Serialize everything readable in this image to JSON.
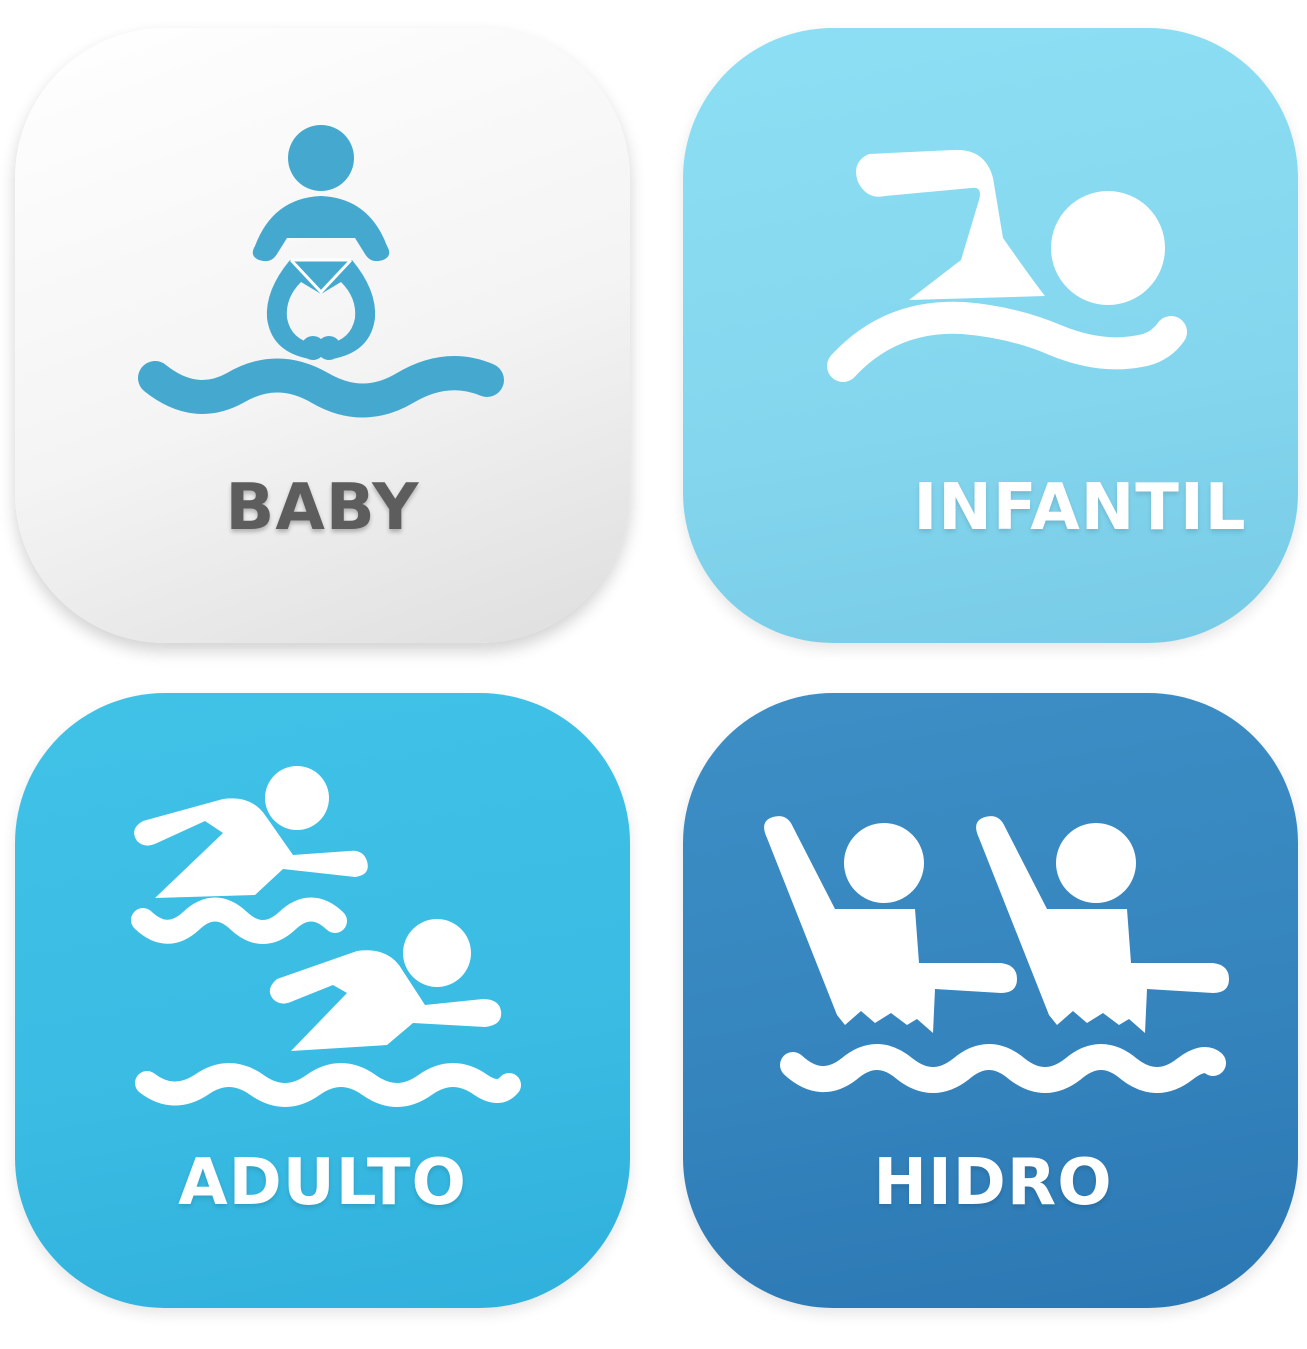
{
  "tiles": [
    {
      "id": "baby",
      "label": "BABY",
      "icon": "baby-swim-icon",
      "background": "#f4f4f4",
      "icon_color": "#45a9cf",
      "label_color": "#5d5d5d"
    },
    {
      "id": "infantil",
      "label": "INFANTIL",
      "icon": "swimmer-icon",
      "background": "#84d6ee",
      "icon_color": "#ffffff",
      "label_color": "#ffffff"
    },
    {
      "id": "adulto",
      "label": "ADULTO",
      "icon": "two-swimmers-icon",
      "background": "#39bbe3",
      "icon_color": "#ffffff",
      "label_color": "#ffffff"
    },
    {
      "id": "hidro",
      "label": "HIDRO",
      "icon": "water-aerobics-icon",
      "background": "#3483bd",
      "icon_color": "#ffffff",
      "label_color": "#ffffff"
    }
  ]
}
